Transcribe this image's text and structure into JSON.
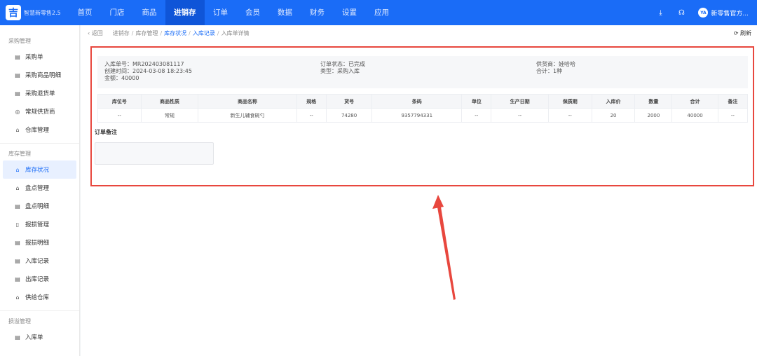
{
  "header": {
    "logo_char": "吉",
    "app_name": "智慧新零售2.5",
    "nav": [
      "首页",
      "门店",
      "商品",
      "进销存",
      "订单",
      "会员",
      "数据",
      "财务",
      "设置",
      "应用"
    ],
    "active_nav_index": 3,
    "avatar_text": "YA",
    "user_name": "新零售官方..."
  },
  "sidebar": {
    "groups": [
      {
        "title": "采购管理",
        "items": [
          "采购单",
          "采购商品明细",
          "采购退货单",
          "常规供货商",
          "仓库管理"
        ]
      },
      {
        "title": "库存管理",
        "items": [
          "库存状况",
          "盘点管理",
          "盘点明细",
          "报损管理",
          "报损明细",
          "入库记录",
          "出库记录",
          "供给仓库"
        ]
      },
      {
        "title": "损溢管理",
        "items": [
          "入库单"
        ]
      }
    ],
    "active_item": "库存状况"
  },
  "breadcrumb": {
    "back": "返回",
    "parts": [
      "进销存",
      "库存管理",
      "库存状况",
      "入库记录",
      "入库单详情"
    ],
    "refresh": "刷新"
  },
  "detail": {
    "order_no": "入库单号：MR202403081117",
    "created_at": "创建时间：2024-03-08 18:23:45",
    "amount": "金额：40000",
    "order_status": "订单状态：已完成",
    "type": "类型：采购入库",
    "supplier": "供货商：娃哈哈",
    "total": "合计：1种"
  },
  "table": {
    "columns": [
      "库位号",
      "商品性质",
      "商品名称",
      "规格",
      "货号",
      "条码",
      "单位",
      "生产日期",
      "保质期",
      "入库价",
      "数量",
      "合计",
      "备注"
    ],
    "rows": [
      [
        "--",
        "常规",
        "新生儿辅食碗勺",
        "--",
        "74280",
        "9357794331",
        "--",
        "--",
        "--",
        "20",
        "2000",
        "40000",
        "--"
      ]
    ]
  },
  "remark": {
    "title": "订单备注",
    "value": ""
  },
  "colors": {
    "primary": "#1a6cf7",
    "highlight_border": "#e8473e",
    "arrow": "#e8473e"
  }
}
